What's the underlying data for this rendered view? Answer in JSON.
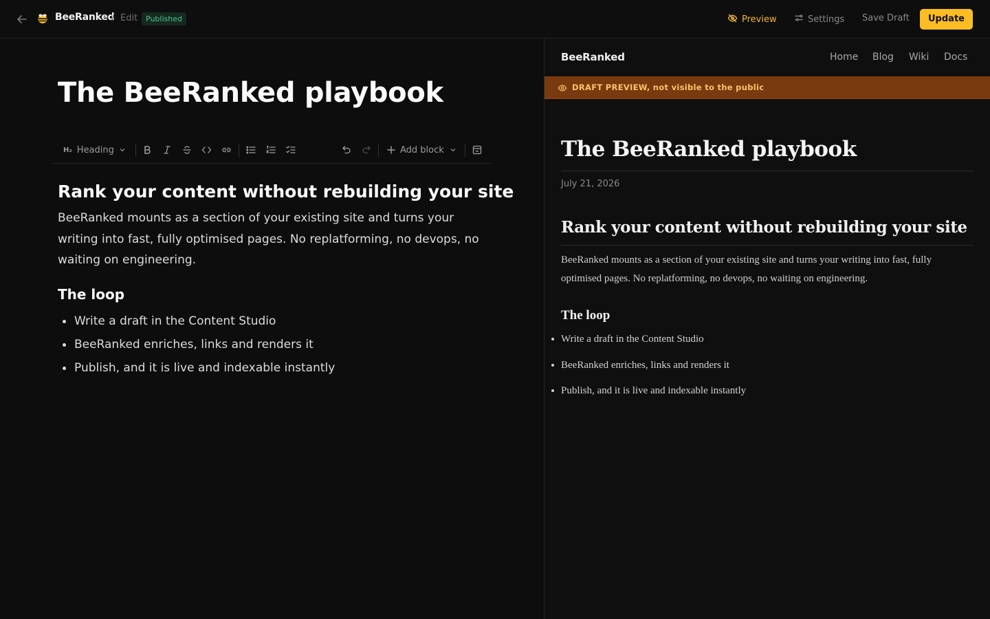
{
  "topbar": {
    "brand": "BeeRanked",
    "separator": "/",
    "crumb": "Edit",
    "status_badge": "Published",
    "preview_label": "Preview",
    "settings_label": "Settings",
    "save_draft_label": "Save Draft",
    "update_label": "Update"
  },
  "editor": {
    "title": "The BeeRanked playbook",
    "toolbar": {
      "heading_icon_text": "H₂",
      "block_type": "Heading",
      "add_block_label": "Add block"
    },
    "content": {
      "h2": "Rank your content without rebuilding your site",
      "paragraph": "BeeRanked mounts as a section of your existing site and turns your writing into fast, fully optimised pages. No replatforming, no devops, no waiting on engineering.",
      "h3": "The loop",
      "list": [
        "Write a draft in the Content Studio",
        "BeeRanked enriches, links and renders it",
        "Publish, and it is live and indexable instantly"
      ]
    }
  },
  "preview": {
    "brand": "BeeRanked",
    "nav": [
      "Home",
      "Blog",
      "Wiki",
      "Docs"
    ],
    "banner": "DRAFT PREVIEW, not visible to the public",
    "title": "The BeeRanked playbook",
    "date": "July 21, 2026",
    "h2": "Rank your content without rebuilding your site",
    "paragraph": "BeeRanked mounts as a section of your existing site and turns your writing into fast, fully optimised pages. No replatforming, no devops, no waiting on engineering.",
    "h3": "The loop",
    "list": [
      "Write a draft in the Content Studio",
      "BeeRanked enriches, links and renders it",
      "Publish, and it is live and indexable instantly"
    ]
  },
  "colors": {
    "accent": "#fbbc24",
    "preview_link": "#f4b63a",
    "badge_text": "#4cc38a",
    "banner_bg": "#7a3a0f",
    "banner_text": "#f7c46a"
  },
  "icons": [
    "back-arrow-icon",
    "bee-logo-icon",
    "eye-off-icon",
    "sliders-icon",
    "heading-icon",
    "chevron-down-icon",
    "bold-icon",
    "italic-icon",
    "strikethrough-icon",
    "code-icon",
    "link-icon",
    "bullet-list-icon",
    "ordered-list-icon",
    "checklist-icon",
    "undo-icon",
    "redo-icon",
    "plus-icon",
    "archive-icon",
    "eye-icon"
  ]
}
